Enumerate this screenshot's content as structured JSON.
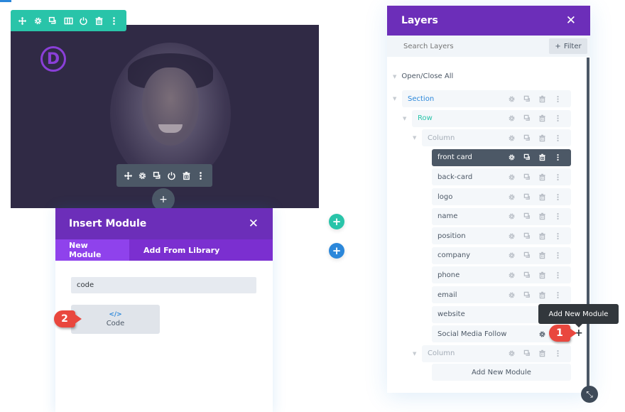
{
  "section_preview": {
    "logo_letter": "D",
    "section_toolbar": [
      "move-icon",
      "gear-icon",
      "duplicate-icon",
      "columns-icon",
      "power-icon",
      "trash-icon",
      "more-icon"
    ],
    "module_toolbar": [
      "move-icon",
      "gear-icon",
      "duplicate-icon",
      "power-icon",
      "trash-icon",
      "more-icon"
    ],
    "add_row_label": "+"
  },
  "insert_module": {
    "title": "Insert Module",
    "close_label": "✕",
    "tabs": [
      {
        "label": "New Module",
        "active": true
      },
      {
        "label": "Add From Library",
        "active": false
      }
    ],
    "search_value": "code",
    "results": [
      {
        "icon": "</>",
        "label": "Code"
      }
    ]
  },
  "floating_buttons": {
    "add_green": "+",
    "add_blue": "+"
  },
  "callouts": {
    "step1": "1",
    "step2": "2"
  },
  "layers": {
    "title": "Layers",
    "close_label": "✕",
    "search_placeholder": "Search Layers",
    "filter_label": "Filter",
    "filter_icon": "+",
    "open_close_all": "Open/Close All",
    "items": [
      {
        "name": "Section",
        "type": "section",
        "color": "#2b87da"
      },
      {
        "name": "Row",
        "type": "row",
        "color": "#29c4a9"
      },
      {
        "name": "Column",
        "type": "column",
        "color": "#a3acb6"
      },
      {
        "name": "front card",
        "type": "module",
        "active": true
      },
      {
        "name": "back-card",
        "type": "module"
      },
      {
        "name": "logo",
        "type": "module"
      },
      {
        "name": "name",
        "type": "module"
      },
      {
        "name": "position",
        "type": "module"
      },
      {
        "name": "company",
        "type": "module"
      },
      {
        "name": "phone",
        "type": "module"
      },
      {
        "name": "email",
        "type": "module"
      },
      {
        "name": "website",
        "type": "module"
      },
      {
        "name": "Social Media Follow",
        "type": "module"
      },
      {
        "name": "Column",
        "type": "column",
        "color": "#a3acb6"
      }
    ],
    "add_new_module": "Add New Module",
    "tooltip": "Add New Module",
    "add_plus": "+"
  },
  "colors": {
    "purple_header": "#6c2eb9",
    "purple_tab": "#8f42ec",
    "green": "#29c4a9",
    "blue": "#2b87da",
    "dark_slate": "#4c5866",
    "callout_red": "#e9473e"
  }
}
